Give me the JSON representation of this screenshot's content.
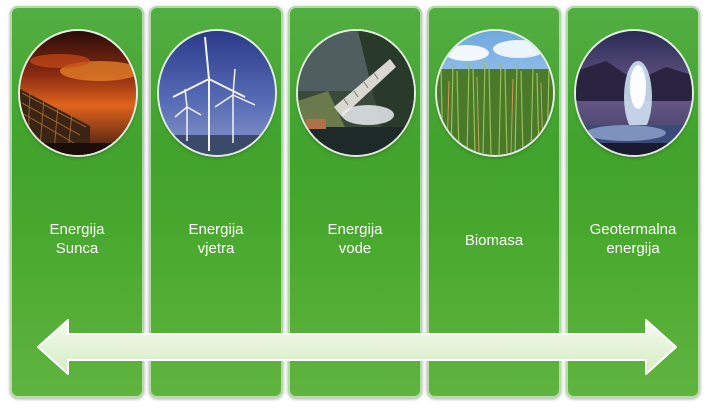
{
  "colors": {
    "panel_green": "#3fa52c",
    "arrow_fill": "#e7f3db",
    "label_text": "#ffffff"
  },
  "panels": [
    {
      "line1": "Energija",
      "line2": "Sunca",
      "image": "solar-panels-sunset-photo"
    },
    {
      "line1": "Energija",
      "line2": "vjetra",
      "image": "wind-turbines-photo"
    },
    {
      "line1": "Energija",
      "line2": "vode",
      "image": "hydro-dam-photo"
    },
    {
      "line1": "Biomasa",
      "line2": "",
      "image": "tall-grass-biomass-photo"
    },
    {
      "line1": "Geotermalna",
      "line2": "energija",
      "image": "geyser-photo"
    }
  ],
  "arrow": {
    "icon": "double-headed-arrow-icon"
  }
}
